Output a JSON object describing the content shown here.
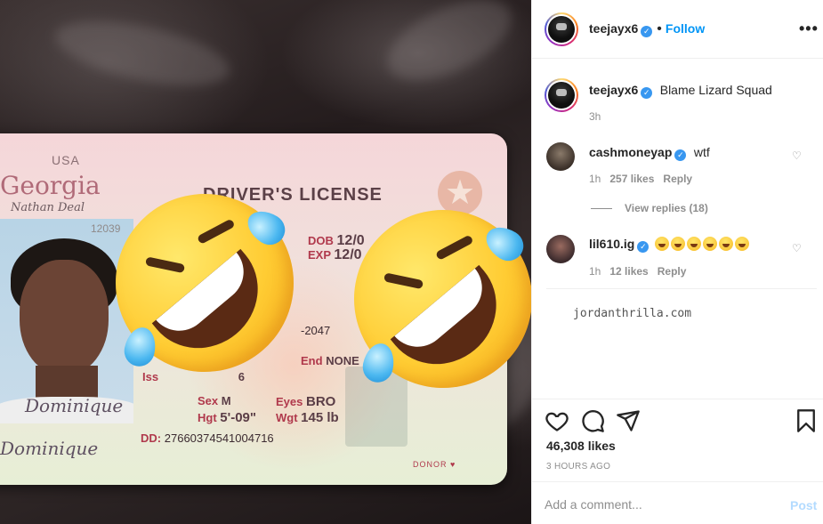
{
  "photo": {
    "card": {
      "country": "USA",
      "state": "Georgia",
      "title": "DRIVER'S LICENSE",
      "signature_top": "Nathan Deal",
      "number_partial": "12039",
      "dob_label": "DOB",
      "dob_value": "12/0",
      "exp_label": "EXP",
      "exp_value": "12/0",
      "partial_code": "-2047",
      "end_label": "End",
      "end_value": "NONE",
      "iss_label": "Iss",
      "iss_partial": "6",
      "sex_label": "Sex",
      "sex_value": "M",
      "hgt_label": "Hgt",
      "hgt_value": "5'-09\"",
      "eyes_label": "Eyes",
      "eyes_value": "BRO",
      "wgt_label": "Wgt",
      "wgt_value": "145 lb",
      "dd_label": "DD",
      "dd_value": "27660374541004716",
      "signature": "Dominique",
      "donor": "DONOR"
    },
    "emoji_icon": "rolling-on-floor-laughing"
  },
  "header": {
    "username": "teejayx6",
    "verified": true,
    "separator": "•",
    "follow_label": "Follow",
    "more_label": "•••"
  },
  "caption": {
    "username": "teejayx6",
    "text": "Blame Lizard Squad",
    "time": "3h"
  },
  "comments": [
    {
      "username": "cashmoneyap",
      "verified": true,
      "text": "wtf",
      "time": "1h",
      "likes": "257 likes",
      "reply_label": "Reply",
      "view_replies": "View replies (18)"
    },
    {
      "username": "lil610.ig",
      "verified": true,
      "text_emoji_count": 6,
      "time": "1h",
      "likes": "12 likes",
      "reply_label": "Reply"
    }
  ],
  "watermark": "jordanthrilla.com",
  "actions": {
    "like_icon": "heart-icon",
    "comment_icon": "comment-icon",
    "share_icon": "share-icon",
    "save_icon": "bookmark-icon",
    "likes_count": "46,308 likes",
    "posted_ago": "3 HOURS AGO"
  },
  "add_comment": {
    "placeholder": "Add a comment...",
    "post_label": "Post"
  },
  "colors": {
    "link_blue": "#0095f6",
    "verified_blue": "#3897f0",
    "muted": "#8e8e8e",
    "post_disabled": "#b3dbff"
  }
}
